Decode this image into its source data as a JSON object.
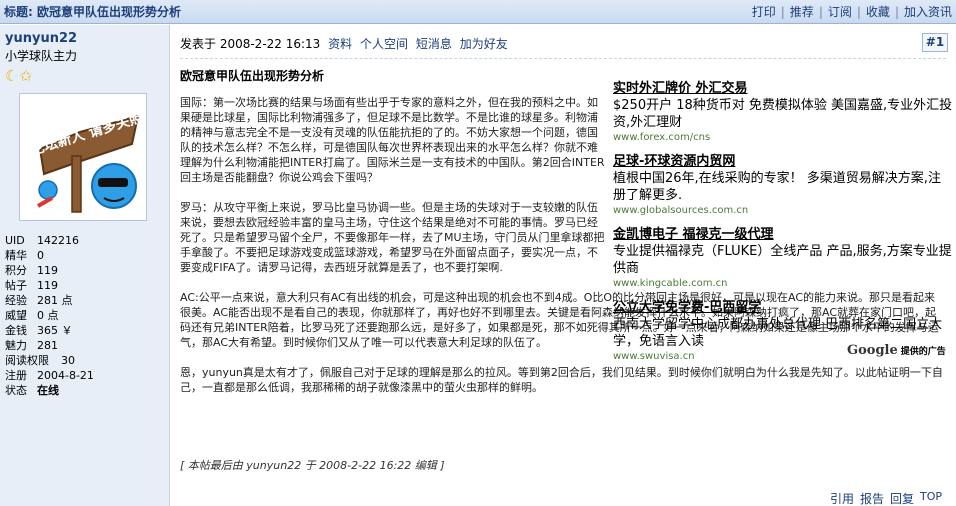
{
  "header": {
    "title": "标题: 欧冠意甲队伍出现形势分析",
    "actions": [
      "打印",
      "推荐",
      "订阅",
      "收藏",
      "加入资讯"
    ]
  },
  "user": {
    "name": "yunyun22",
    "title": "小学球队主力",
    "avatar_text": "论坛新人 请多关照",
    "stats": [
      {
        "k": "UID",
        "v": "142216"
      },
      {
        "k": "精华",
        "v": "0"
      },
      {
        "k": "积分",
        "v": "119"
      },
      {
        "k": "帖子",
        "v": "119"
      },
      {
        "k": "经验",
        "v": "281 点"
      },
      {
        "k": "威望",
        "v": "0 点"
      },
      {
        "k": "金钱",
        "v": "365 ￥"
      },
      {
        "k": "魅力",
        "v": "281"
      },
      {
        "k": "阅读权限",
        "v": "30"
      },
      {
        "k": "注册",
        "v": "2004-8-21"
      },
      {
        "k": "状态",
        "v": "在线"
      }
    ]
  },
  "post": {
    "posted_label": "发表于 2008-2-22 16:13",
    "links": [
      "资料",
      "个人空间",
      "短消息",
      "加为好友"
    ],
    "floor": "#1",
    "title": "欧冠意甲队伍出现形势分析",
    "paragraphs": [
      "国际：第一次场比赛的结果与场面有些出乎于专家的意料之外，但在我的预料之中。如果硬是比球星，国际比利物浦强多了，但足球不是比数学。不是比谁的球星多。利物浦的精神与意志完全不是一支没有灵魂的队伍能抗拒的了的。不妨大家想一个问题，德国队的技术怎么样？不怎么样，可是德国队每次世界杯表现出来的水平怎么样？你就不难理解为什么利物浦能把INTER打扁了。国际米兰是一支有技术的中国队。第2回合INTER回主场是否能翻盘？你说公鸡会下蛋吗？",
      "罗马：从攻守平衡上来说，罗马比皇马协调一些。但是主场的失球对于一支较嫩的队伍来说，要想去欧冠经验丰富的皇马主场，守住这个结果是绝对不可能的事情。罗马已经死了。只是希望罗马留个全尸，不要像那年一样，去了MU主场，守门员从门里拿球都把手拿酸了。不要把足球游戏变成篮球游戏，希望罗马在外面留点面子，要实况一点，不要变成FIFA了。请罗马记得，去西班牙就算是丢了，也不要打架啊.",
      "AC:公平一点来说，意大利只有AC有出线的机会，可是这种出现的机会也不到4成。O比O的比分带回主场是很好，可是以现在AC的能力来说。那只是看起来很美。AC能否出现不是看自己的表现，你就那样了，再好也好不到哪里去。关键是看阿森纳能发挥什么水平。如果阿森纳打疯了，那AC就葬在家门口吧，起码还有兄弟INTER陪着，比罗马死了还要跑那么远，是好多了，如果都是死，那不如死得其所一点。好一点来看，阿森纳如果还是像主场那个水平的发挥与运气，那AC大有希望。到时候你们又从了唯一可以代表意大利足球的队伍了。",
      "恩，yunyun真是太有才了，佩服自己对于足球的理解是那么的拉风。等到第2回合后，我们见结果。到时候你们就明白为什么我是先知了。以此帖证明一下自己，一直都是那么低调，我那稀稀的胡子就像漆黑中的萤火虫那样的鲜明。"
    ],
    "edit_note": "[ 本帖最后由 yunyun22 于 2008-2-22 16:22 编辑 ]",
    "bottom_actions": [
      "引用",
      "报告",
      "回复",
      "TOP"
    ]
  },
  "ads": [
    {
      "headline": "实时外汇牌价 外汇交易",
      "desc": "$250开户 18种货币对 免费模拟体验 美国嘉盛,专业外汇投资,外汇理财",
      "url": "www.forex.com/cns"
    },
    {
      "headline": "足球-环球资源内贸网",
      "desc": "植根中国26年,在线采购的专家！ 多渠道贸易解决方案,注册了解更多.",
      "url": "www.globalsources.com.cn"
    },
    {
      "headline": "金凯博电子 福禄克一级代理",
      "desc": "专业提供福禄克（FLUKE）全线产品 产品,服务,方案专业提供商",
      "url": "www.kingcable.com.cn"
    },
    {
      "headline": "公立大学免学费-巴西留学",
      "desc": "西南大学留学中心成都办事处总代理 巴西排名第二国立大学，免语言入读",
      "url": "www.swuvisa.cn"
    }
  ],
  "google_label": {
    "brand": "Google",
    "tag": "提供的广告"
  },
  "colors": {
    "accent": "#1d3f7a",
    "sidebar_bg": "#e7eef8",
    "title_bg": "#c9daf0"
  }
}
